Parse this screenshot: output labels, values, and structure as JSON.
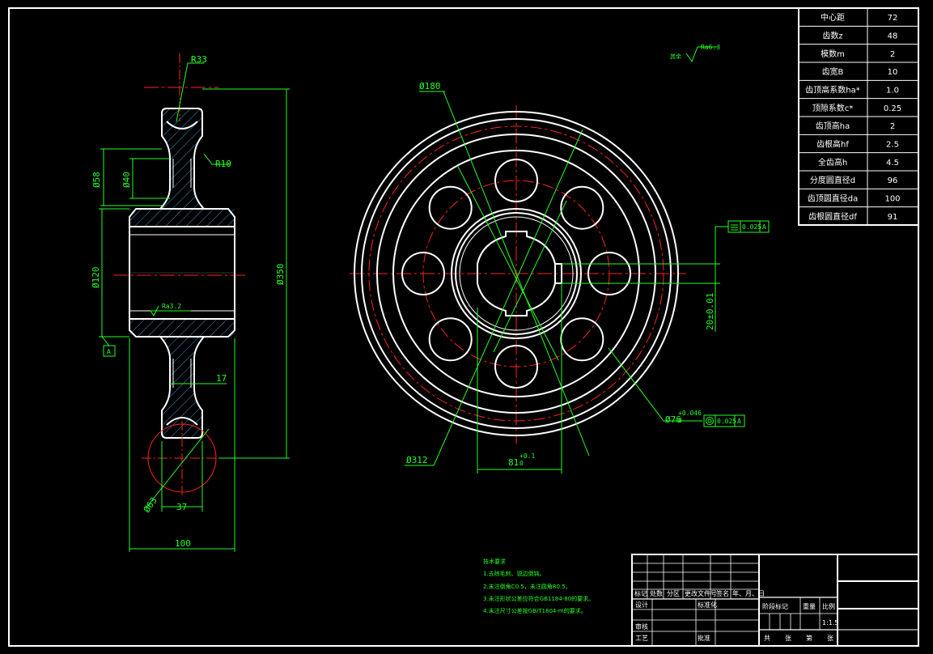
{
  "params": [
    {
      "label": "中心距",
      "value": "72"
    },
    {
      "label": "齿数z",
      "value": "48"
    },
    {
      "label": "模数m",
      "value": "2"
    },
    {
      "label": "齿宽B",
      "value": "10"
    },
    {
      "label": "齿顶高系数ha*",
      "value": "1.0"
    },
    {
      "label": "顶隙系数c*",
      "value": "0.25"
    },
    {
      "label": "齿顶高ha",
      "value": "2"
    },
    {
      "label": "齿根高hf",
      "value": "2.5"
    },
    {
      "label": "全齿高h",
      "value": "4.5"
    },
    {
      "label": "分度圆直径d",
      "value": "96"
    },
    {
      "label": "齿顶圆直径da",
      "value": "100"
    },
    {
      "label": "齿根圆直径df",
      "value": "91"
    }
  ],
  "side_dims": {
    "r33": "R33",
    "r10": "R10",
    "d58": "Ø58",
    "d40": "Ø40",
    "d120": "Ø120",
    "d350": "Ø350",
    "ra32": "Ra3.2",
    "datum": "A",
    "w17": "17",
    "d63": "Ø63",
    "w37": "37",
    "w100": "100"
  },
  "front_dims": {
    "ra63": "Ra6.3",
    "rest": "其余",
    "d180": "Ø180",
    "d312": "Ø312",
    "d76": "Ø76",
    "d76_tol_up": "+0.046",
    "d76_tol_lo": "0",
    "w81": "81",
    "w81_tol_up": "+0.1",
    "w81_tol_lo": "0",
    "h20": "20±0.01",
    "gt1_val": "0.025",
    "gt1_ref": "A",
    "gt2_val": "0.025",
    "gt2_ref": "A"
  },
  "notes": {
    "title": "技术要求",
    "lines": [
      "1.去除毛刺、锐边倒钝。",
      "2.未注倒角C0.5，未注圆角R0.5。",
      "3.未注形状公差应符合GB1184-80的要求。",
      "4.未注尺寸公差按GB/T1804-m的要求。"
    ]
  },
  "title_block": {
    "row_labels": [
      "标记",
      "处数",
      "分区",
      "更改文件号",
      "签名",
      "年、月、日"
    ],
    "design": "设计",
    "standard": "标准化",
    "stage": "阶段标记",
    "weight": "重量",
    "ratio": "比例",
    "scale": "1:1.5",
    "review": "审核",
    "process": "工艺",
    "approve": "批准",
    "sheets": [
      "共",
      "张",
      "第",
      "张"
    ]
  }
}
